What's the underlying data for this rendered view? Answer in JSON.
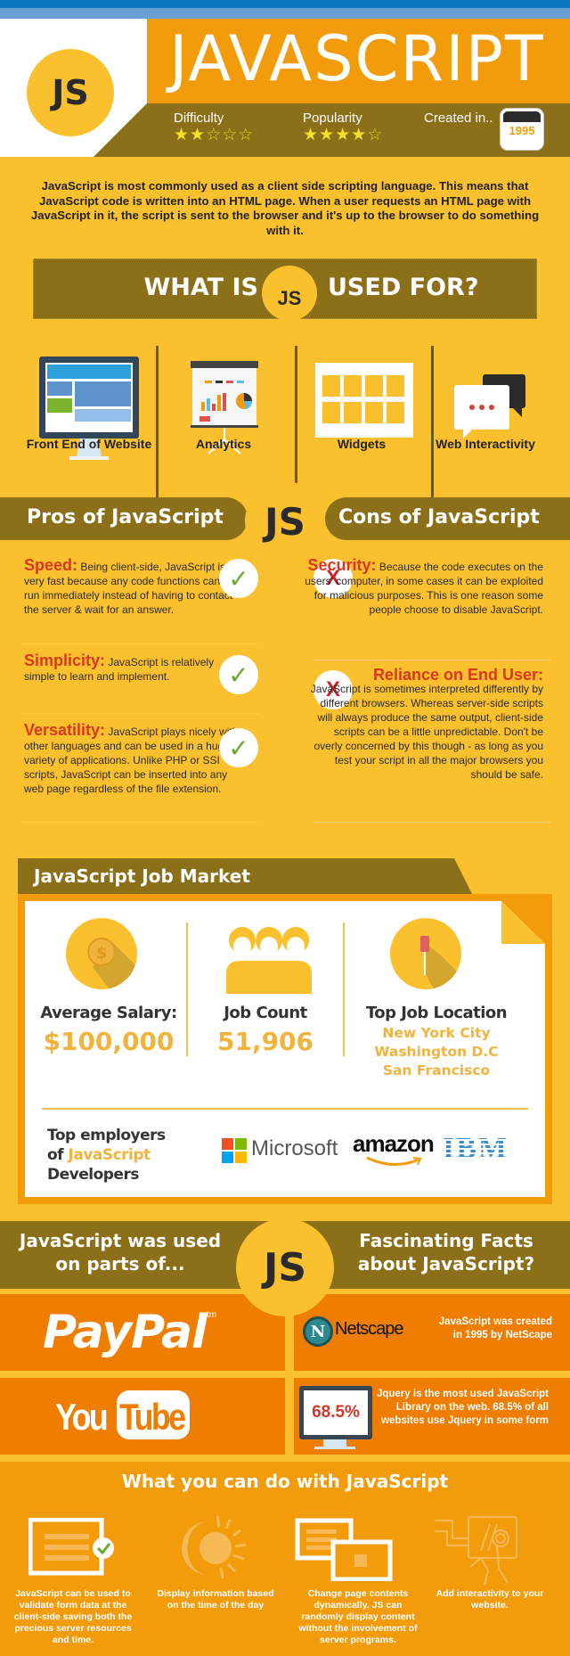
{
  "header": {
    "logo": "JS",
    "title": "JAVASCRIPT",
    "difficulty_label": "Difficulty",
    "difficulty_rating": {
      "value": 2,
      "max": 5
    },
    "popularity_label": "Popularity",
    "popularity_rating": {
      "value": 4,
      "max": 5
    },
    "created_label": "Created in..",
    "created_year": "1995"
  },
  "intro": "JavaScript is most commonly used as a client side scripting language. This means that JavaScript code is written into an HTML page. When a user requests an HTML page with JavaScript in it, the script is sent to the browser and it's up to the browser to do something with it.",
  "what_is": {
    "left": "WHAT IS",
    "badge": "JS",
    "right": "USED FOR?",
    "uses": [
      {
        "icon": "monitor-website-icon",
        "label": "Front End of Website"
      },
      {
        "icon": "presentation-chart-icon",
        "label": "Analytics"
      },
      {
        "icon": "widgets-grid-icon",
        "label": "Widgets"
      },
      {
        "icon": "chat-bubbles-icon",
        "label": "Web Interactivity"
      }
    ]
  },
  "pros_cons": {
    "pros_title": "Pros of JavaScript",
    "cons_title": "Cons of JavaScript",
    "badge": "JS",
    "pros": [
      {
        "keyword": "Speed:",
        "text": "Being client-side, JavaScript is very fast because any code functions can be run immediately instead of having to contact the server & wait for an answer."
      },
      {
        "keyword": "Simplicity:",
        "text": "JavaScript is relatively simple to learn and implement."
      },
      {
        "keyword": "Versatility:",
        "text": "JavaScript plays nicely with other languages and can be used in a huge variety of applications. Unlike PHP or SSI scripts, JavaScript can be inserted into any web page regardless of the file extension."
      }
    ],
    "cons": [
      {
        "keyword": "Security:",
        "text": "Because the code executes on the users' computer, in some cases it can be exploited for malicious purposes. This is one reason some people choose to disable JavaScript."
      },
      {
        "keyword": "Reliance on End User:",
        "text": "JavaScript is sometimes interpreted differently by different browsers. Whereas server-side scripts will always produce the same output, client-side scripts can be a little unpredictable. Don't be overly concerned by this though - as long as you test your script in all the major browsers you should be safe."
      }
    ],
    "check_glyph": "✓",
    "x_glyph": "X"
  },
  "job_market": {
    "title": "JavaScript Job Market",
    "salary_label": "Average Salary:",
    "salary_value": "$100,000",
    "count_label": "Job Count",
    "count_value": "51,906",
    "location_label": "Top Job Location",
    "locations": [
      "New York City",
      "Washington D.C",
      "San Francisco"
    ],
    "employers_line1": "Top employers",
    "employers_of": "of ",
    "employers_hl": "JavaScript",
    "employers_line3": "Developers",
    "employers": [
      "Microsoft",
      "amazon",
      "IBM"
    ]
  },
  "used_on": {
    "left_title": "JavaScript was used on parts of...",
    "right_title": "Fascinating Facts about JavaScript?",
    "badge": "JS",
    "sites": [
      "PayPal",
      "YouTube"
    ],
    "paypal_tm": "tm",
    "youtube_you": "You",
    "youtube_tube": "Tube",
    "netscape_logo": "N",
    "netscape_name": "Netscape",
    "fact1": "JavaScript was created in 1995 by NetScape",
    "jquery_stat": "68.5%",
    "fact2": "Jquery is the most used JavaScript Library on the web. 68.5% of all websites use Jquery in some form"
  },
  "what_you_can_do": {
    "title": "What you can do with JavaScript",
    "items": [
      {
        "icon": "form-validate-icon",
        "text": "JavaScript can be used to validate form data at the client-side saving both the precious server resources and time."
      },
      {
        "icon": "sun-moon-icon",
        "text": "Display information based on the time of the day"
      },
      {
        "icon": "windows-icon",
        "text": "Change page contents dynamically. JS can randomly display content without the involvement of server programs."
      },
      {
        "icon": "touch-tablet-icon",
        "text": "Add interactivity to your website."
      }
    ]
  },
  "colors": {
    "background_yellow": "#fbc02d",
    "olive": "#8c7019",
    "orange": "#f39c0b",
    "deep_orange": "#ef7d00",
    "keyword_red": "#d9381e",
    "value_gold": "#f0b33c",
    "check_green": "#6aa82c"
  }
}
